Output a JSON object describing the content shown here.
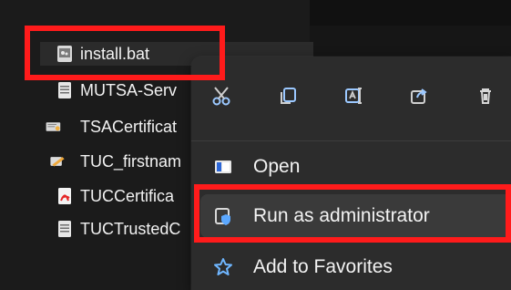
{
  "files": [
    {
      "name": "install.bat",
      "icon": "batch-file-icon"
    },
    {
      "name": "MUTSA-Serv",
      "icon": "text-file-icon"
    },
    {
      "name": "TSACertificat",
      "icon": "certificate-file-icon"
    },
    {
      "name": "TUC_firstnam",
      "icon": "script-file-icon"
    },
    {
      "name": "TUCCertifica",
      "icon": "pdf-file-icon"
    },
    {
      "name": "TUCTrustedC",
      "icon": "text-file-icon"
    }
  ],
  "context_menu": {
    "actions": [
      {
        "name": "cut",
        "icon": "cut-icon"
      },
      {
        "name": "copy",
        "icon": "copy-icon"
      },
      {
        "name": "rename",
        "icon": "rename-icon"
      },
      {
        "name": "share",
        "icon": "share-icon"
      },
      {
        "name": "delete",
        "icon": "delete-icon"
      }
    ],
    "items": [
      {
        "label": "Open",
        "icon": "open-icon"
      },
      {
        "label": "Run as administrator",
        "icon": "shield-icon"
      },
      {
        "label": "Add to Favorites",
        "icon": "star-icon"
      }
    ]
  },
  "colors": {
    "highlight": "#ff1b1b",
    "menu_background": "#2c2c2c",
    "selected_item": "#3a3a3a",
    "accent": "#60a5ff"
  }
}
